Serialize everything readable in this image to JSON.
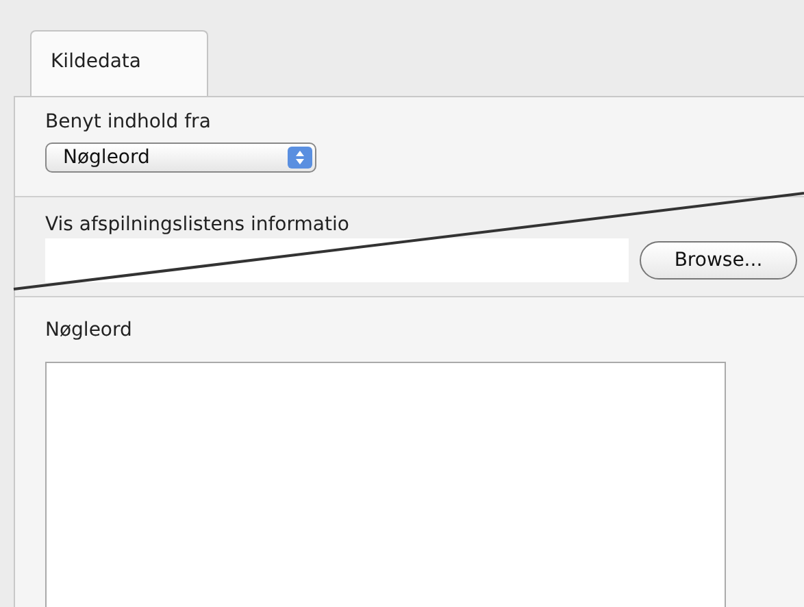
{
  "tabs": [
    {
      "label": "Kildedata",
      "selected": true
    }
  ],
  "source": {
    "label": "Benyt indhold fra",
    "popup": "Nøgleord"
  },
  "playlist_info": {
    "label": "Vis afspilningslistens informatio",
    "button": "Browse..."
  },
  "keywords": {
    "label": "Nøgleord"
  }
}
